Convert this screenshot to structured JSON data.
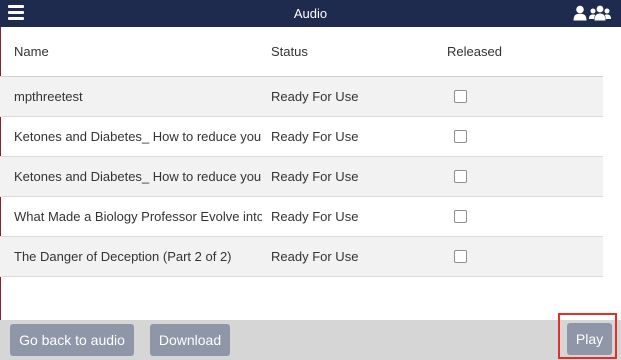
{
  "header": {
    "title": "Audio"
  },
  "table": {
    "columns": [
      "Name",
      "Status",
      "Released"
    ],
    "rows": [
      {
        "name": "mpthreetest",
        "status": "Ready For Use",
        "released": false
      },
      {
        "name": "Ketones and Diabetes_ How to reduce you",
        "status": "Ready For Use",
        "released": false
      },
      {
        "name": "Ketones and Diabetes_ How to reduce you",
        "status": "Ready For Use",
        "released": false
      },
      {
        "name": "What Made a Biology Professor Evolve into",
        "status": "Ready For Use",
        "released": false
      },
      {
        "name": "The Danger of Deception (Part 2 of 2)",
        "status": "Ready For Use",
        "released": false
      }
    ]
  },
  "footer": {
    "back_label": "Go back to audio",
    "download_label": "Download",
    "play_label": "Play"
  },
  "colors": {
    "topbar": "#1e2a4e",
    "button": "#8e96a8",
    "highlight": "#e0302c"
  },
  "icons": [
    "hamburger-menu-icon",
    "user-icon",
    "users-group-icon"
  ]
}
